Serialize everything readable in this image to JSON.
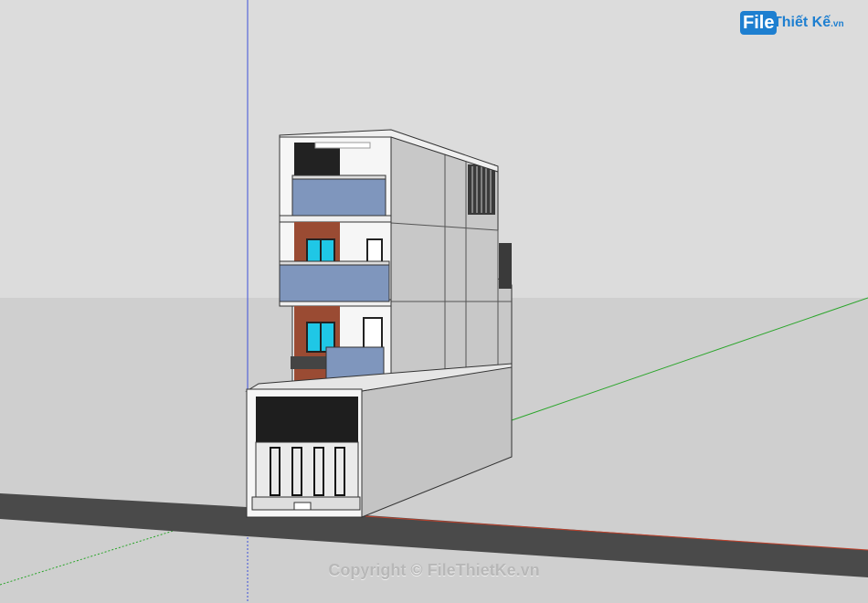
{
  "watermark": {
    "logo_file": "File",
    "logo_name": "Thiết Kế",
    "logo_tld": ".vn",
    "copyright": "Copyright © FileThietKe.vn"
  },
  "colors": {
    "sky": "#dcdcdc",
    "ground": "#cfcfcf",
    "road": "#4a4a4a",
    "wall_front": "#f6f6f6",
    "wall_side": "#c4c4c4",
    "glass": "#7f96bd",
    "brick": "#9a4b33",
    "window_cyan": "#1fc7e6",
    "axis_blue": "#3b4fd8",
    "axis_green": "#2aa52a",
    "axis_red": "#c0402a"
  }
}
